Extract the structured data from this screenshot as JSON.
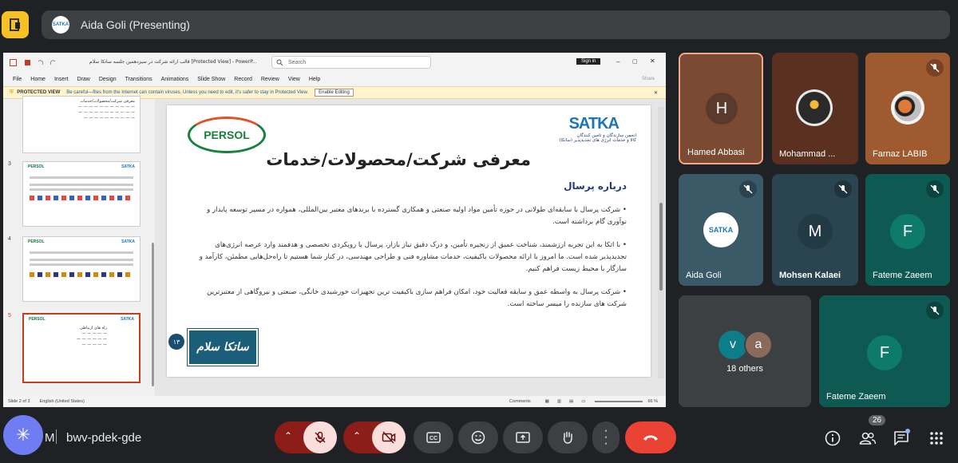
{
  "meeting": {
    "presenter_label": "Aida Goli (Presenting)",
    "time_partial": "M",
    "code": "bwv-pdek-gde",
    "participant_count": "26"
  },
  "powerpoint": {
    "window_title": "قالب ارائه شرکت در سیزدهمین جلسه ساتکا سلام  [Protected View]  -  PowerP...",
    "search_placeholder": "Search",
    "sign_in": "Sign in",
    "share_label": "Share",
    "menu": [
      "File",
      "Home",
      "Insert",
      "Draw",
      "Design",
      "Transitions",
      "Animations",
      "Slide Show",
      "Record",
      "Review",
      "View",
      "Help"
    ],
    "protected_label": "PROTECTED VIEW",
    "protected_msg": "Be careful—files from the Internet can contain viruses. Unless you need to edit, it's safer to stay in Protected View.",
    "enable_editing": "Enable Editing",
    "status_slide": "Slide 2 of 3",
    "status_lang": "English (United States)",
    "status_comments": "Comments",
    "status_zoom": "66 %",
    "thumb_numbers": [
      "3",
      "4",
      "5"
    ]
  },
  "slide": {
    "persol": "PERSOL",
    "satka": "SATKA",
    "satka_sub1": "انجمن سازندگان و تامین کنندگان",
    "satka_sub2": "کالا و خدمات انرژی های تجدیدپذیر (ساتکا)",
    "title": "معرفی شرکت/محصولات/خدمات",
    "subtitle": "درباره پرسال",
    "bullets": [
      "شرکت پرسال با سابقه‌ای طولانی در حوزه تأمین مواد اولیه صنعتی و همکاری گسترده با برندهای معتبر بین‌المللی، همواره در مسیر توسعه پایدار و نوآوری گام برداشته است.",
      "با اتکا به این تجربه ارزشمند، شناخت عمیق از زنجیره تأمین، و درک دقیق نیاز بازار، پرسال با رویکردی تخصصی و هدفمند وارد عرصه انرژی‌های تجدیدپذیر شده است. ما امروز با ارائه محصولات باکیفیت، خدمات مشاوره فنی و طراحی مهندسی، در کنار شما هستیم تا راه‌حل‌هایی مطمئن، کارآمد و سازگار با محیط زیست فراهم کنیم.",
      "شرکت پرسال به واسطه عمق و سابقه فعالیت خود، امکان فراهم سازی باکیفیت ترین تجهیزات خورشیدی خانگی، صنعتی و نیروگاهی از معتبرترین شرکت های سازنده را میسر ساخته است."
    ],
    "badge_number": "۱۳",
    "stamp_text": "ساتکا سلام"
  },
  "tiles": [
    {
      "name": "Hamed Abbasi",
      "initial": "H",
      "bg": "#7a4a32",
      "circle": "#5a3a2c",
      "active": true,
      "muted": false
    },
    {
      "name": "Mohammad ...",
      "initial": "",
      "bg": "#5a3020",
      "circle": "#2a2a2a",
      "active": false,
      "muted": false
    },
    {
      "name": "Farnaz LABIB",
      "initial": "",
      "bg": "#a05a30",
      "circle": "#e07a3a",
      "active": false,
      "muted": true
    },
    {
      "name": "Aida Goli",
      "initial": "",
      "bg": "#3a5a68",
      "circle": "#ffffff",
      "active": false,
      "muted": true
    },
    {
      "name": "Mohsen Kalaei",
      "initial": "M",
      "bg": "#2a4450",
      "circle": "#223a44",
      "active": false,
      "muted": true
    },
    {
      "name": "Fateme Zaeem",
      "initial": "F",
      "bg": "#0e5a52",
      "circle": "#0d7a6a",
      "active": false,
      "muted": true
    },
    {
      "name": "Fateme Zaeem",
      "initial": "F",
      "bg": "#0e5a52",
      "circle": "#0d7a6a",
      "active": false,
      "muted": true
    }
  ],
  "others": {
    "label": "18 others",
    "avatar1": "v",
    "avatar2": "a"
  },
  "colors": {
    "end_call": "#ea4335",
    "muted_bg": "#f9dedc",
    "muted_group": "#8c1d18",
    "active_border": "#f2a98a"
  }
}
